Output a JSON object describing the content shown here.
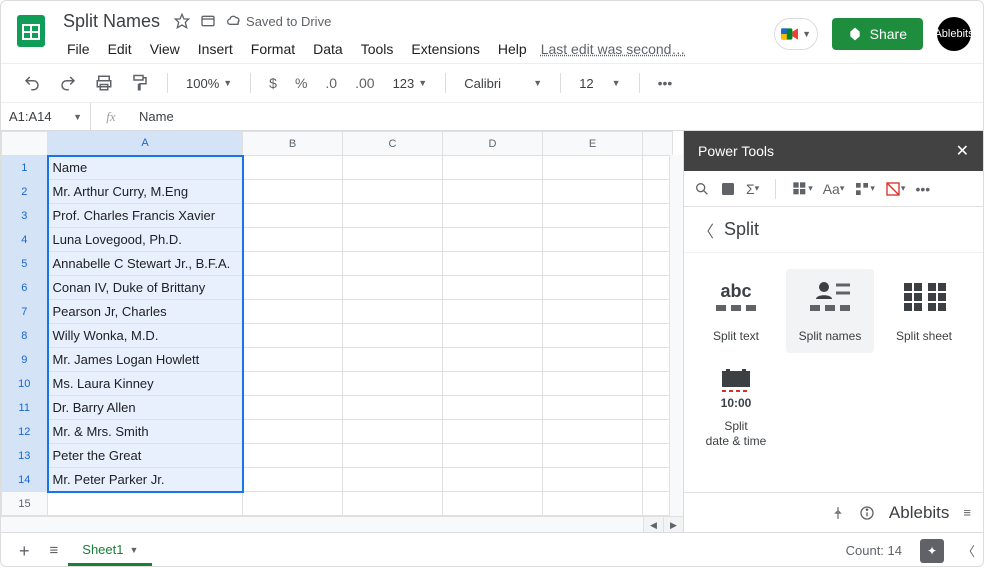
{
  "doc": {
    "title": "Split Names",
    "saved": "Saved to Drive",
    "last_edit": "Last edit was second…"
  },
  "menus": [
    "File",
    "Edit",
    "View",
    "Insert",
    "Format",
    "Data",
    "Tools",
    "Extensions",
    "Help"
  ],
  "toolbar": {
    "zoom": "100%",
    "num_fmt": "123",
    "font": "Calibri",
    "size": "12"
  },
  "namebox": "A1:A14",
  "formula": "Name",
  "columns": [
    "A",
    "B",
    "C",
    "D",
    "E"
  ],
  "rows": [
    {
      "n": 1,
      "a": "Name",
      "bold": true
    },
    {
      "n": 2,
      "a": "Mr. Arthur Curry, M.Eng"
    },
    {
      "n": 3,
      "a": "Prof. Charles Francis Xavier"
    },
    {
      "n": 4,
      "a": "Luna Lovegood, Ph.D."
    },
    {
      "n": 5,
      "a": "Annabelle C Stewart Jr., B.F.A."
    },
    {
      "n": 6,
      "a": "Conan IV, Duke of Brittany"
    },
    {
      "n": 7,
      "a": "Pearson Jr, Charles"
    },
    {
      "n": 8,
      "a": "Willy Wonka, M.D."
    },
    {
      "n": 9,
      "a": "Mr. James Logan Howlett"
    },
    {
      "n": 10,
      "a": "Ms. Laura Kinney"
    },
    {
      "n": 11,
      "a": "Dr. Barry Allen"
    },
    {
      "n": 12,
      "a": "Mr. & Mrs. Smith"
    },
    {
      "n": 13,
      "a": "Peter the Great"
    },
    {
      "n": 14,
      "a": "Mr. Peter Parker Jr."
    },
    {
      "n": 15,
      "a": ""
    }
  ],
  "selected_rows": 14,
  "sidebar": {
    "title": "Power Tools",
    "section": "Split",
    "items": [
      {
        "id": "split-text",
        "label": "Split text"
      },
      {
        "id": "split-names",
        "label": "Split names",
        "active": true
      },
      {
        "id": "split-sheet",
        "label": "Split sheet"
      },
      {
        "id": "split-date-time",
        "label": "Split\ndate & time"
      }
    ],
    "brand": "Ablebits"
  },
  "share_label": "Share",
  "avatar_label": "Ablebits",
  "tab": {
    "add": "+",
    "menu": "≡",
    "name": "Sheet1"
  },
  "status": {
    "count": "Count: 14"
  }
}
